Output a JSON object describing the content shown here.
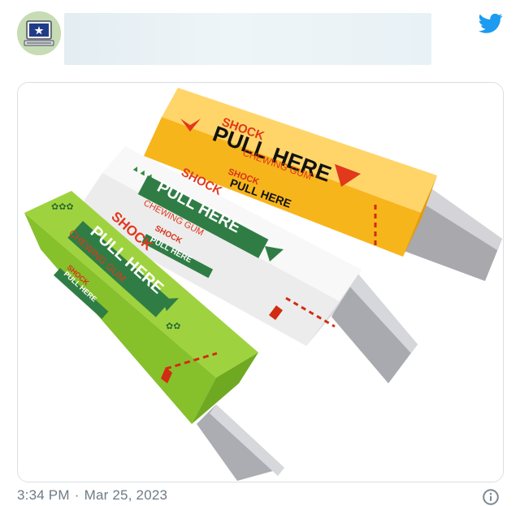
{
  "tweet": {
    "time": "3:34 PM",
    "separator": "·",
    "date": "Mar 25, 2023"
  },
  "icons": {
    "brand": "twitter-bird-icon",
    "info": "info-icon",
    "brand_color": "#1d9bf0"
  },
  "image": {
    "packs": [
      {
        "color": "green",
        "logo_text": "",
        "shock": "SHOCK",
        "pull": "PULL HERE",
        "gum": "CHEWING GUM",
        "small_shock": "SHOCK",
        "small_pull": "PULL HERE"
      },
      {
        "color": "white",
        "logo_text": "",
        "shock": "SHOCK",
        "pull": "PULL HERE",
        "gum": "CHEWING GUM",
        "small_shock": "SHOCK",
        "small_pull": "PULL HERE"
      },
      {
        "color": "yellow",
        "logo_text": "",
        "shock": "SHOCK",
        "pull": "PULL HERE",
        "gum": "CHEWING GUM",
        "small_shock": "SHOCK",
        "small_pull": "PULL HERE"
      }
    ]
  }
}
